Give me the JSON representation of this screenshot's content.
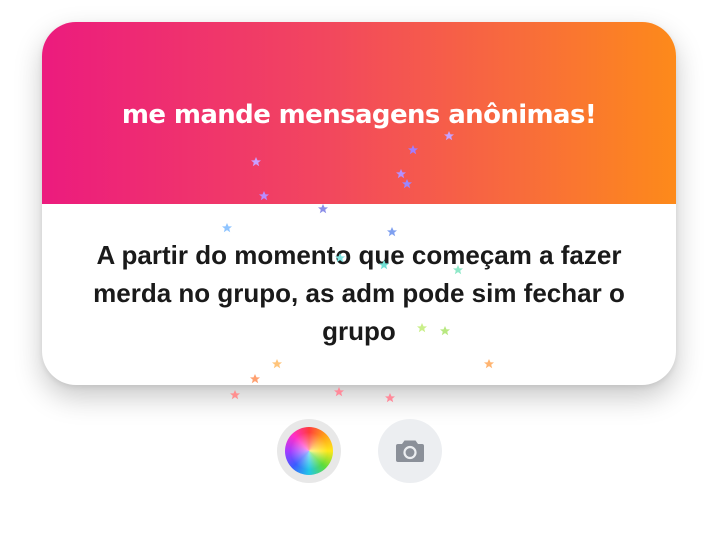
{
  "card": {
    "header_title": "me mande mensagens anônimas!",
    "message": "A partir do momento que começam a fazer merda no grupo, as adm pode sim fechar o grupo"
  },
  "colors": {
    "gradient_start": "#ec1b7e",
    "gradient_end": "#fd8a1a",
    "text": "#1a1a1a"
  },
  "actions": {
    "color_button_icon": "color-wheel-icon",
    "camera_button_icon": "camera-icon"
  }
}
